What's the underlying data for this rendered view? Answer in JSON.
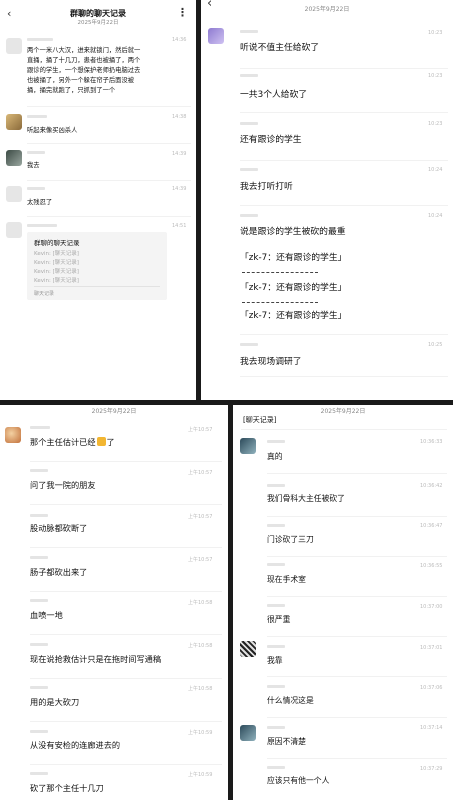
{
  "panel1": {
    "title": "群聊的聊天记录",
    "date": "2025年9月22日",
    "messages": [
      {
        "time": "14:36",
        "lines": [
          "两个一米八大汉，进来就锁门，然后就一",
          "直捅，捅了十几刀，患者也被捅了，两个",
          "跟诊的学生，一个想保护老师扔电脑过去",
          "也被捅了，另外一个躲在帘子后面没被",
          "捅，捅完就跑了，只抓到了一个"
        ]
      },
      {
        "time": "14:38",
        "lines": [
          "听起来像买凶杀人"
        ]
      },
      {
        "time": "14:39",
        "lines": [
          "我去"
        ]
      },
      {
        "time": "14:39",
        "lines": [
          "太残忍了"
        ]
      },
      {
        "time": "14:51",
        "lines": []
      }
    ],
    "card": {
      "title": "群聊的聊天记录",
      "lines": [
        "Kevin: [聊天记录]",
        "Kevin: [聊天记录]",
        "Kevin: [聊天记录]",
        "Kevin: [聊天记录]"
      ],
      "footer": "聊天记录"
    }
  },
  "panel2": {
    "date": "2025年9月22日",
    "messages": [
      {
        "time": "10:23",
        "text": "听说不值主任给砍了"
      },
      {
        "time": "10:23",
        "text": "一共3个人给砍了"
      },
      {
        "time": "10:23",
        "text": "还有跟诊的学生"
      },
      {
        "time": "10:24",
        "text": "我去打听打听"
      },
      {
        "time": "10:24",
        "text": "说是跟诊的学生被砍的最重"
      },
      {
        "time": "10:25",
        "text": "我去现场调研了"
      }
    ],
    "quote_text": "「zk-7：还有跟诊的学生」",
    "separator": "- - - - - - - - - - - - - - -"
  },
  "panel3": {
    "date": "2025年9月22日",
    "messages": [
      {
        "time": "上午10:57",
        "text": "那个主任估计已经",
        "emoji": "💀",
        "suffix": "了"
      },
      {
        "time": "上午10:57",
        "text": "问了我一院的朋友"
      },
      {
        "time": "上午10:57",
        "text": "股动脉都砍断了"
      },
      {
        "time": "上午10:57",
        "text": "肠子都砍出来了"
      },
      {
        "time": "上午10:58",
        "text": "血喷一地"
      },
      {
        "time": "上午10:58",
        "text": "现在说抢救估计只是在拖时间写通稿"
      },
      {
        "time": "上午10:58",
        "text": "用的是大砍刀"
      },
      {
        "time": "上午10:59",
        "text": "从没有安检的连廊进去的"
      },
      {
        "time": "上午10:59",
        "text": "砍了那个主任十几刀"
      }
    ]
  },
  "panel4": {
    "date": "2025年9月22日",
    "top_text": "[聊天记录]",
    "messages": [
      {
        "time": "10:36:33",
        "text": "真的"
      },
      {
        "time": "10:36:42",
        "text": "我们骨科大主任被砍了"
      },
      {
        "time": "10:36:47",
        "text": "门诊砍了三刀"
      },
      {
        "time": "10:36:55",
        "text": "现在手术室"
      },
      {
        "time": "10:37:00",
        "text": "很严重"
      },
      {
        "time": "10:37:01",
        "text": "我靠"
      },
      {
        "time": "10:37:06",
        "text": "什么情况这是"
      },
      {
        "time": "10:37:14",
        "text": "原因不清楚"
      },
      {
        "time": "10:37:29",
        "text": "应该只有他一个人"
      }
    ]
  },
  "icons": {
    "back": "chevron-left-icon",
    "more": "more-icon"
  }
}
